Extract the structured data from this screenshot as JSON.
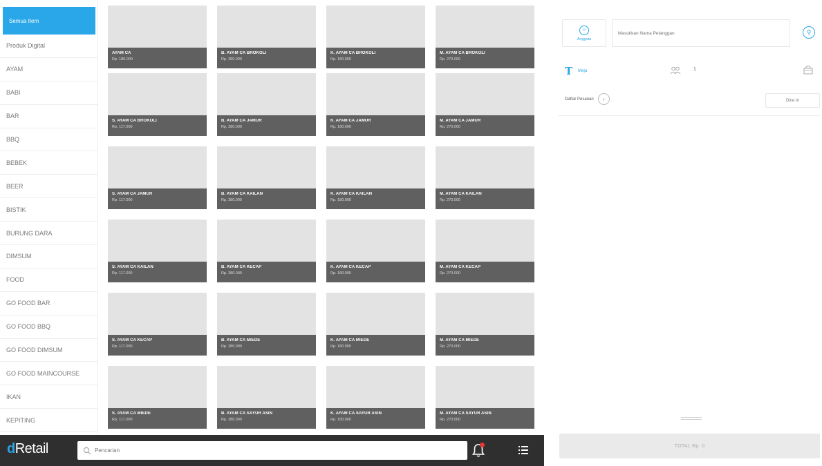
{
  "categories": [
    {
      "label": "Semua Item",
      "active": true
    },
    {
      "label": "Produk Digital"
    },
    {
      "label": "AYAM"
    },
    {
      "label": "BABI"
    },
    {
      "label": "BAR"
    },
    {
      "label": "BBQ"
    },
    {
      "label": "BEBEK"
    },
    {
      "label": "BEER"
    },
    {
      "label": "BISTIK"
    },
    {
      "label": "BURUNG DARA"
    },
    {
      "label": "DIMSUM"
    },
    {
      "label": "FOOD"
    },
    {
      "label": "GO FOOD BAR"
    },
    {
      "label": "GO FOOD BBQ"
    },
    {
      "label": "GO FOOD DIMSUM"
    },
    {
      "label": "GO FOOD MAINCOURSE"
    },
    {
      "label": "IKAN"
    },
    {
      "label": "KEPITING"
    }
  ],
  "products": [
    {
      "name": "AYAM CA",
      "price": "Rp. 180.000"
    },
    {
      "name": "B. AYAM CA BROKOLI",
      "price": "Rp. 380.000"
    },
    {
      "name": "K. AYAM CA BROKOLI",
      "price": "Rp. 180.000"
    },
    {
      "name": "M. AYAM CA BROKOLI",
      "price": "Rp. 270.000"
    },
    {
      "name": "S. AYAM CA BROKOLI",
      "price": "Rp. 117.000"
    },
    {
      "name": "B. AYAM CA JAMUR",
      "price": "Rp. 380.000"
    },
    {
      "name": "K. AYAM CA JAMUR",
      "price": "Rp. 180.000"
    },
    {
      "name": "M. AYAM CA JAMUR",
      "price": "Rp. 270.000"
    },
    {
      "name": "S. AYAM CA JAMUR",
      "price": "Rp. 117.000"
    },
    {
      "name": "B. AYAM CA KAILAN",
      "price": "Rp. 380.000"
    },
    {
      "name": "K. AYAM CA KAILAN",
      "price": "Rp. 180.000"
    },
    {
      "name": "M. AYAM CA KAILAN",
      "price": "Rp. 270.000"
    },
    {
      "name": "S. AYAM CA KAILAN",
      "price": "Rp. 117.000"
    },
    {
      "name": "B. AYAM CA KECAP",
      "price": "Rp. 380.000"
    },
    {
      "name": "K. AYAM CA KECAP",
      "price": "Rp. 180.000"
    },
    {
      "name": "M. AYAM CA KECAP",
      "price": "Rp. 270.000"
    },
    {
      "name": "S. AYAM CA KECAP",
      "price": "Rp. 117.000"
    },
    {
      "name": "B. AYAM CA MIEDE",
      "price": "Rp. 380.000"
    },
    {
      "name": "K. AYAM CA MIEDE",
      "price": "Rp. 180.000"
    },
    {
      "name": "M. AYAM CA MIEDE",
      "price": "Rp. 270.000"
    },
    {
      "name": "S. AYAM CA MIEDE",
      "price": "Rp. 117.000"
    },
    {
      "name": "B. AYAM CA SAYUR ASIN",
      "price": "Rp. 380.000"
    },
    {
      "name": "K. AYAM CA SAYUR ASIN",
      "price": "Rp. 180.000"
    },
    {
      "name": "M. AYAM CA SAYUR ASIN",
      "price": "Rp. 270.000"
    }
  ],
  "bottombar": {
    "logo_prefix": "d",
    "logo_rest": "Retail",
    "search_placeholder": "Pencarian",
    "search_icon": "search-icon",
    "bell_icon": "bell-icon",
    "menu_icon": "list-menu-icon"
  },
  "panel": {
    "guest_label": "Anggota",
    "customer_placeholder": "Masukkan Nama Pelanggan",
    "table_label": "Meja",
    "guest_count": "1",
    "order_list_label": "Daftar Pesanan",
    "dine_label": "Dine In",
    "total_label": "TOTAL Rp. 0"
  },
  "colors": {
    "accent": "#2aa7e8",
    "bar": "#2f2f2f",
    "tile": "#e3e3e3",
    "tile_label": "#606060",
    "notification": "#e53935"
  }
}
